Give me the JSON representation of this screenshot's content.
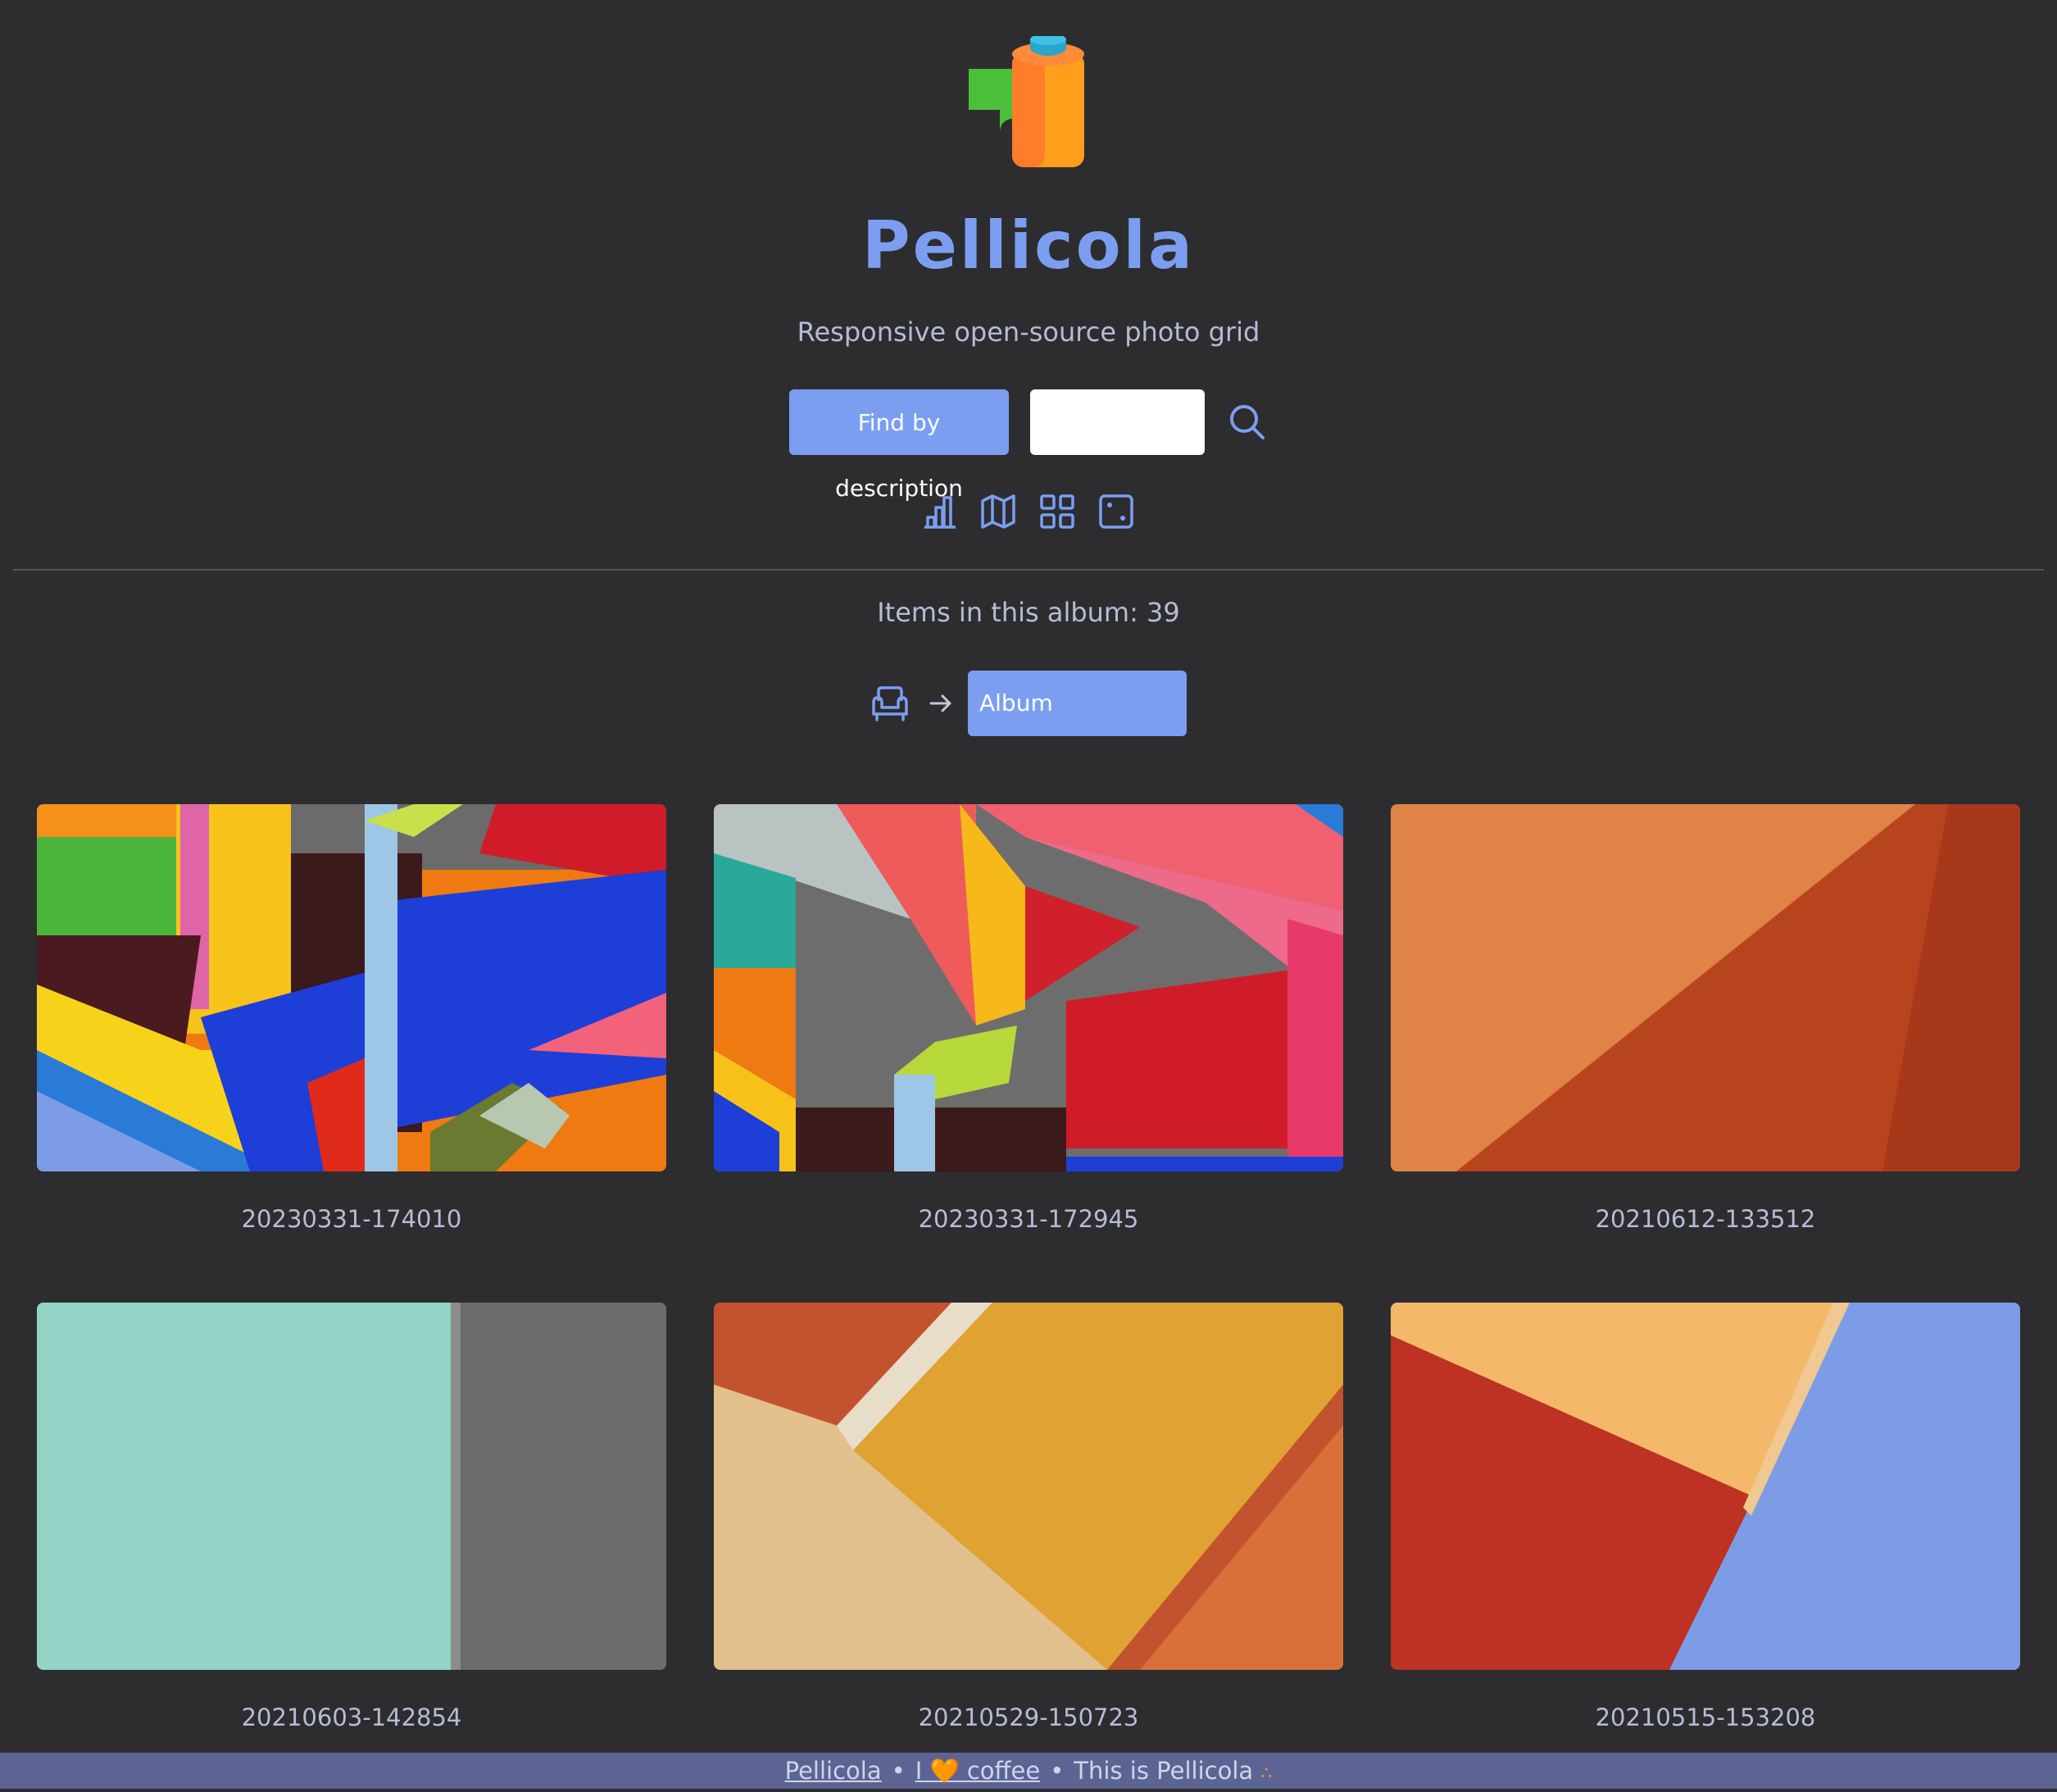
{
  "app": {
    "title": "Pellicola",
    "subtitle": "Responsive open-source photo grid"
  },
  "search": {
    "button_label": "Find by description",
    "value": "",
    "placeholder": ""
  },
  "toolbar": {
    "icons": [
      "stats-icon",
      "map-icon",
      "grid-icon",
      "random-icon"
    ]
  },
  "album": {
    "count_label": "Items in this album: 39",
    "breadcrumb": {
      "home_icon": "armchair-icon",
      "separator_icon": "arrow-right-icon",
      "current": "Album"
    }
  },
  "photos": [
    {
      "caption": "20230331-174010"
    },
    {
      "caption": "20230331-172945"
    },
    {
      "caption": "20210612-133512"
    },
    {
      "caption": "20210603-142854"
    },
    {
      "caption": "20210529-150723"
    },
    {
      "caption": "20210515-153208"
    }
  ],
  "footer": {
    "link_pellicola": "Pellicola",
    "sep1": "•",
    "coffee_prefix": "I",
    "coffee_heart": "🧡",
    "coffee_word": "coffee",
    "sep2": "•",
    "tagline": "This is Pellicola",
    "tagline_dots": "∴"
  },
  "colors": {
    "accent": "#7b9ef0",
    "background": "#2d2d2f",
    "footer": "#5c6494"
  }
}
